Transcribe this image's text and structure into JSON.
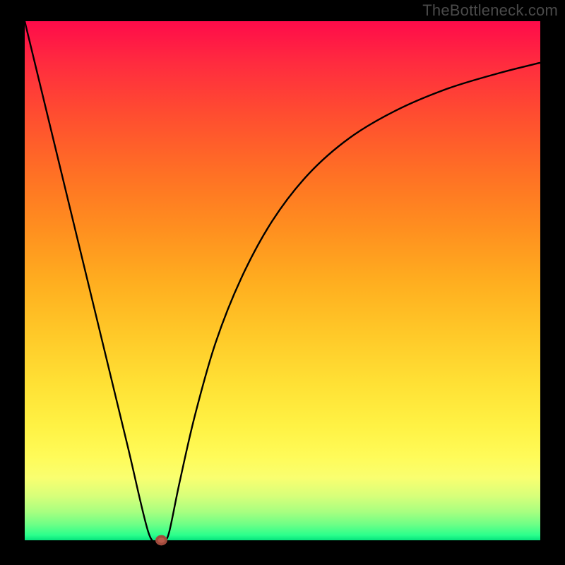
{
  "watermark": "TheBottleneck.com",
  "chart_data": {
    "type": "line",
    "title": "",
    "xlabel": "",
    "ylabel": "",
    "xlim": [
      0,
      100
    ],
    "ylim": [
      0,
      100
    ],
    "series": [
      {
        "name": "bottleneck-curve",
        "x": [
          0,
          5,
          10,
          15,
          20,
          24,
          26,
          27,
          28,
          30,
          33,
          37,
          42,
          48,
          55,
          63,
          72,
          82,
          92,
          100
        ],
        "y": [
          100,
          79.5,
          59,
          38.5,
          18,
          1.5,
          0,
          0,
          1.5,
          11,
          24,
          38,
          50.5,
          61.5,
          70.5,
          77.5,
          82.8,
          87,
          90,
          92
        ]
      }
    ],
    "marker": {
      "name": "bottleneck-point",
      "x": 26.5,
      "y": 0
    },
    "gradient": {
      "direction": "vertical",
      "stops": [
        {
          "pos": 0,
          "color": "#ff0b4a"
        },
        {
          "pos": 50,
          "color": "#ffad1f"
        },
        {
          "pos": 85,
          "color": "#fffb59"
        },
        {
          "pos": 100,
          "color": "#06e37d"
        }
      ]
    }
  }
}
